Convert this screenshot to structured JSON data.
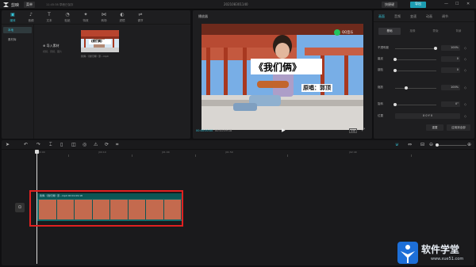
{
  "titlebar": {
    "app_name": "剪映",
    "menu": "菜单",
    "autosave": "11:45:38 草稿已保存",
    "project_title": "202108301140",
    "shortcut": "快捷键",
    "export": "导出",
    "min_icon": "—",
    "max_icon": "☐",
    "close_icon": "✕"
  },
  "media": {
    "tools": [
      {
        "icon": "▣",
        "label": "媒体",
        "name": "media-icon"
      },
      {
        "icon": "♪",
        "label": "音频",
        "name": "audio-icon"
      },
      {
        "icon": "T",
        "label": "文本",
        "name": "text-icon"
      },
      {
        "icon": "◔",
        "label": "贴纸",
        "name": "sticker-icon"
      },
      {
        "icon": "✦",
        "label": "特效",
        "name": "effects-icon"
      },
      {
        "icon": "⋈",
        "label": "转场",
        "name": "transition-icon"
      },
      {
        "icon": "◐",
        "label": "滤镜",
        "name": "filter-icon"
      },
      {
        "icon": "⇌",
        "label": "调节",
        "name": "adjust-icon"
      }
    ],
    "sidenav": [
      "本地",
      "素材库"
    ],
    "import_label": "导入素材",
    "import_hint": "视频、音频、图片",
    "thumb_title": "《我们俩》",
    "file_name": "我俩-《我们俩》原...mp4"
  },
  "player": {
    "title": "播放器",
    "caption_main": "《我们俩》",
    "caption_sub": "原唱：郭顶",
    "current_time": "00:00:00:00",
    "total_time": "00:01:09:18",
    "ratio": "原始",
    "qq_logo": "QQ音乐"
  },
  "props": {
    "tabs": [
      "画面",
      "音频",
      "变速",
      "动画",
      "调节"
    ],
    "subtabs": [
      "基础",
      "抠像",
      "蒙版",
      "背景"
    ],
    "rows": [
      {
        "label": "不透明度",
        "value": "100%"
      },
      {
        "label": "磨皮",
        "value": "0"
      },
      {
        "label": "瘦脸",
        "value": "0"
      },
      {
        "label": "缩放",
        "value": "100%"
      },
      {
        "label": "旋转",
        "value": "0°"
      },
      {
        "label": "位置",
        "value": "X  0   Y  0"
      }
    ],
    "reset": "重置",
    "apply_all": "应用到全部"
  },
  "timeline": {
    "ruler": [
      "00:00",
      "|00:10",
      "|01:00",
      "|01:50",
      "|02:40"
    ],
    "clip_label": "我俩-《我们俩》原...mp4   00:01:09:18"
  },
  "watermark": {
    "text": "软件学堂",
    "url": "www.xue51.com"
  }
}
